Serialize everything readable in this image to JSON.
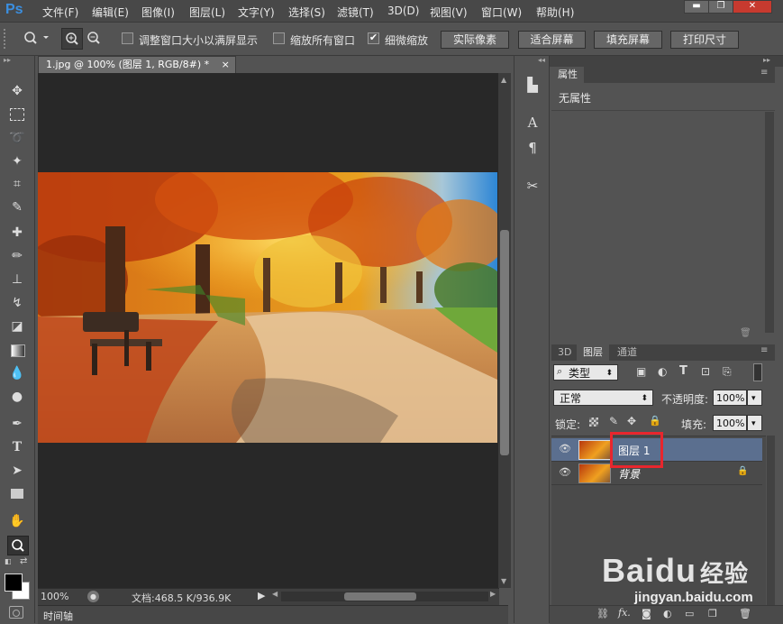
{
  "app": {
    "logo": "Ps"
  },
  "menu": [
    "文件(F)",
    "编辑(E)",
    "图像(I)",
    "图层(L)",
    "文字(Y)",
    "选择(S)",
    "滤镜(T)",
    "3D(D)",
    "视图(V)",
    "窗口(W)",
    "帮助(H)"
  ],
  "window_controls": [
    "▬",
    "❐",
    "✕"
  ],
  "options": {
    "resize_windows": "调整窗口大小以满屏显示",
    "zoom_all": "缩放所有窗口",
    "scrubby_zoom": "细微缩放",
    "scrubby_checked": true,
    "buttons": [
      "实际像素",
      "适合屏幕",
      "填充屏幕",
      "打印尺寸"
    ]
  },
  "document": {
    "tab_title": "1.jpg @ 100% (图层 1, RGB/8#) *",
    "close": "×",
    "zoom": "100%",
    "doc_size": "文档:468.5 K/936.9K"
  },
  "timeline_label": "时间轴",
  "properties": {
    "tab": "属性",
    "content": "无属性"
  },
  "layers_panel": {
    "tabs": [
      "3D",
      "图层",
      "通道"
    ],
    "filter": "类型",
    "blend_mode": "正常",
    "opacity_label": "不透明度:",
    "opacity": "100%",
    "lock_label": "锁定:",
    "fill_label": "填充:",
    "fill": "100%",
    "layers": [
      {
        "name": "图层 1",
        "selected": true,
        "highlighted": true
      },
      {
        "name": "背景",
        "locked": true,
        "italic": true
      }
    ]
  },
  "watermark": {
    "brand": "Bai",
    "paw": "du",
    "suffix": "经验",
    "url": "jingyan.baidu.com"
  },
  "colors": {
    "accent": "#3b8fe0",
    "highlight_box": "#e8262d",
    "selected_layer": "#5b6f8f"
  }
}
